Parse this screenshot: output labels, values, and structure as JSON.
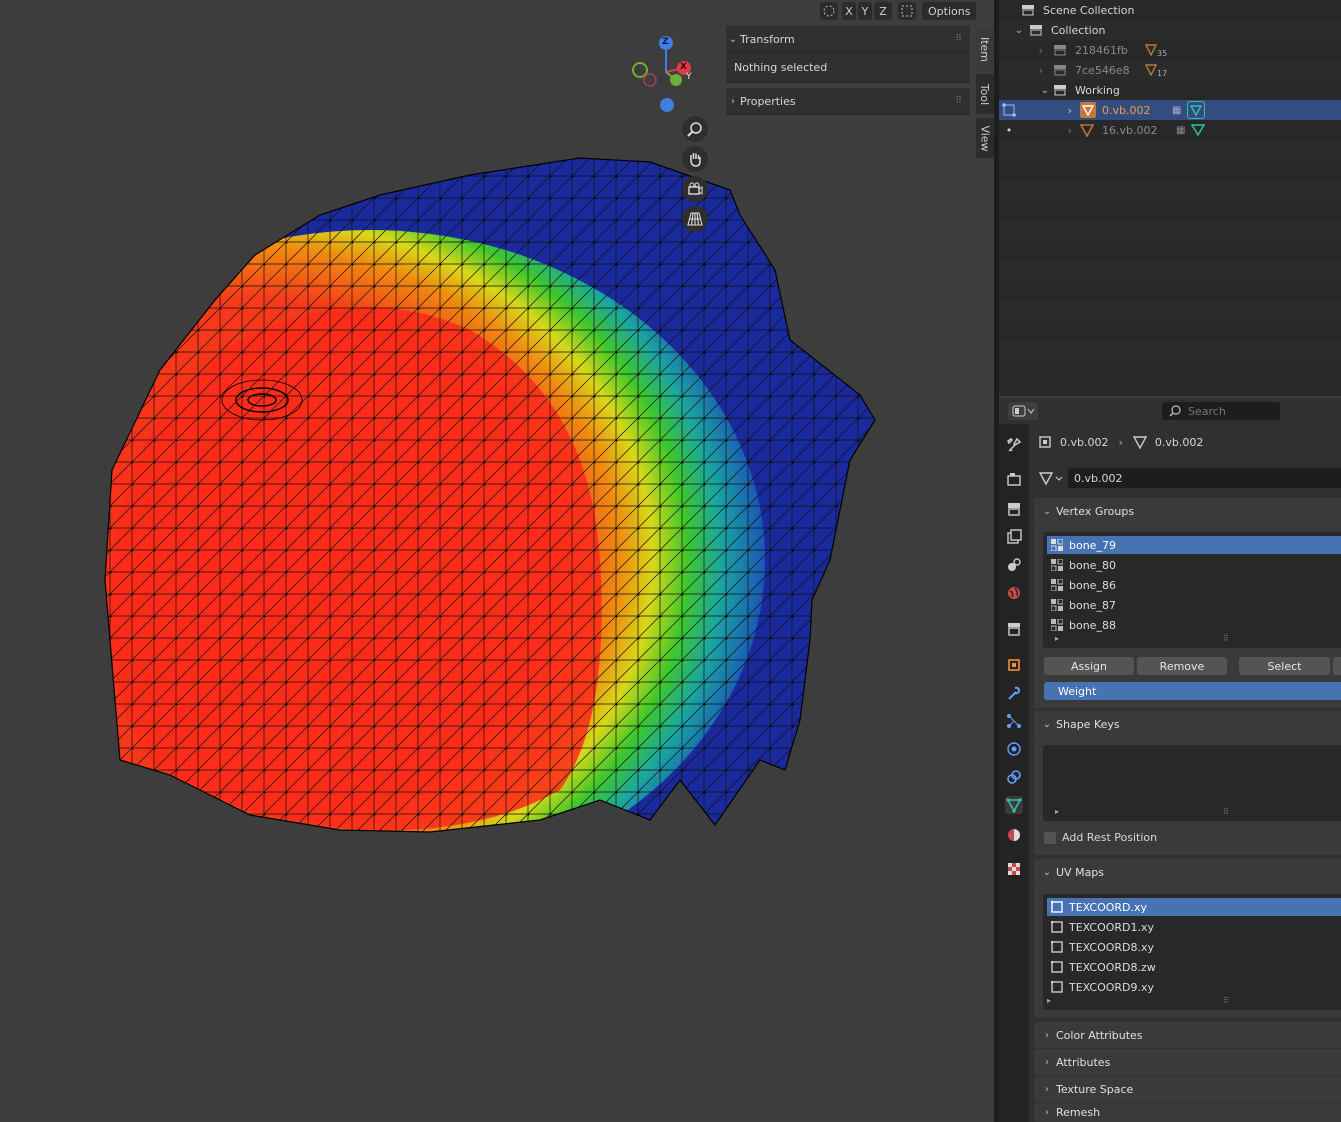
{
  "viewport": {
    "header": {
      "axis_x": "X",
      "axis_y": "Y",
      "axis_z": "Z",
      "options_label": "Options"
    },
    "gizmo": {
      "z": "Z",
      "x": "X",
      "y": "Y"
    },
    "nav_icons": [
      "zoom-icon",
      "pan-hand-icon",
      "camera-icon",
      "perspective-grid-icon"
    ],
    "n_panel": {
      "transform_label": "Transform",
      "nothing_selected": "Nothing selected",
      "properties_label": "Properties",
      "tabs": [
        "Item",
        "Tool",
        "View"
      ]
    }
  },
  "outliner": {
    "scene_collection": "Scene Collection",
    "collection": "Collection",
    "items": [
      {
        "name": "218461fb",
        "badge": "35"
      },
      {
        "name": "7ce546e8",
        "badge": "17"
      }
    ],
    "working": "Working",
    "objects": [
      {
        "name": "0.vb.002",
        "selected": true
      },
      {
        "name": "16.vb.002",
        "selected": false
      }
    ]
  },
  "properties": {
    "search_placeholder": "Search",
    "breadcrumb_object": "0.vb.002",
    "breadcrumb_mesh": "0.vb.002",
    "mesh_name": "0.vb.002",
    "vertex_groups": {
      "title": "Vertex Groups",
      "items": [
        "bone_79",
        "bone_80",
        "bone_86",
        "bone_87",
        "bone_88"
      ],
      "assign": "Assign",
      "remove": "Remove",
      "select": "Select",
      "weight_label": "Weight"
    },
    "shape_keys": {
      "title": "Shape Keys",
      "add_rest_position": "Add Rest Position"
    },
    "uv_maps": {
      "title": "UV Maps",
      "items": [
        "TEXCOORD.xy",
        "TEXCOORD1.xy",
        "TEXCOORD8.xy",
        "TEXCOORD8.zw",
        "TEXCOORD9.xy"
      ]
    },
    "collapsed_panels": [
      "Color Attributes",
      "Attributes",
      "Texture Space",
      "Remesh"
    ]
  },
  "colors": {
    "selection_blue": "#4772b3",
    "outliner_selected": "#334d80",
    "weight_hot": "#ff2a1a",
    "weight_cold": "#1a2a9c",
    "mesh_icon": "#35c0a8"
  }
}
